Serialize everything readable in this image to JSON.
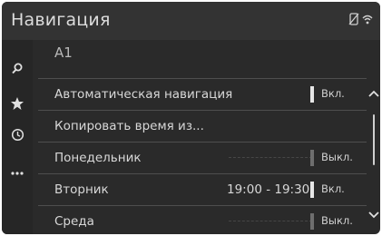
{
  "header": {
    "title": "Навигация"
  },
  "sidebar": {
    "items": [
      {
        "icon": "search-icon"
      },
      {
        "icon": "star-icon"
      },
      {
        "icon": "clock-icon"
      },
      {
        "icon": "more-icon"
      }
    ]
  },
  "main": {
    "subtitle": "A1",
    "rows": [
      {
        "label": "Автоматическая навигация",
        "toggle": "Вкл.",
        "state": "on"
      },
      {
        "label": "Копировать время из..."
      },
      {
        "label": "Понедельник",
        "toggle": "Выкл.",
        "state": "off"
      },
      {
        "label": "Вторник",
        "time": "19:00 - 19:30",
        "toggle": "Вкл.",
        "state": "on"
      },
      {
        "label": "Среда",
        "toggle": "Выкл.",
        "state": "off"
      }
    ]
  },
  "colors": {
    "background": "#2a2a2a",
    "header": "#333333",
    "text": "#d8d8d8",
    "toggle_on": "#e6e6e6",
    "toggle_off": "#6e6e6e"
  }
}
